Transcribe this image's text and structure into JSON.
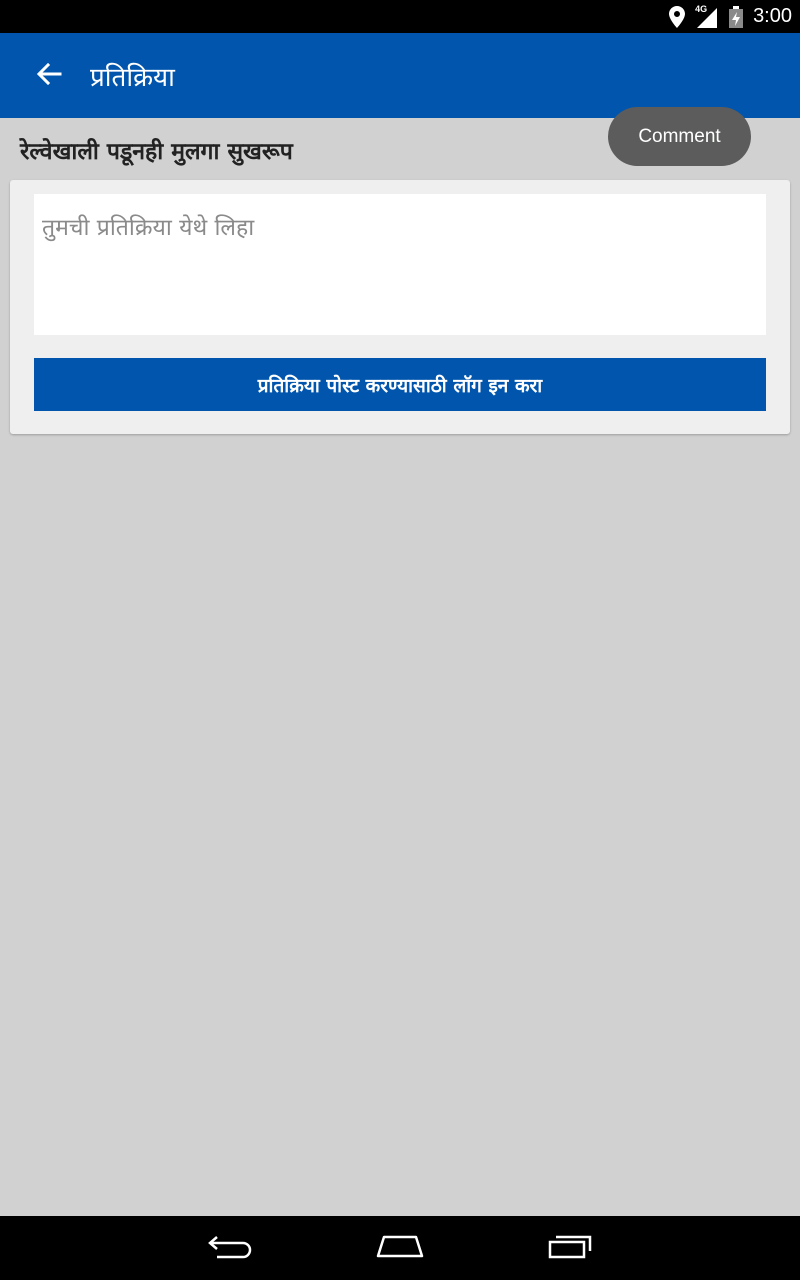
{
  "status_bar": {
    "network": "4G",
    "time": "3:00",
    "icons": [
      "location-icon",
      "signal-icon",
      "battery-icon"
    ]
  },
  "app_bar": {
    "title": "प्रतिक्रिया",
    "back_icon": "arrow-left-icon"
  },
  "article": {
    "headline": "रेल्वेखाली पडूनही मुलगा सुखरूप"
  },
  "toast": {
    "text": "Comment"
  },
  "comment_form": {
    "placeholder": "तुमची प्रतिक्रिया येथे लिहा",
    "value": "",
    "login_button_label": "प्रतिक्रिया पोस्ट करण्यासाठी लॉग इन करा"
  },
  "nav_bar": {
    "icons": [
      "back-icon",
      "home-icon",
      "recents-icon"
    ]
  },
  "colors": {
    "primary": "#0155ad",
    "background": "#d1d1d1",
    "card": "#efefef",
    "toast": "#5b5c5b"
  }
}
